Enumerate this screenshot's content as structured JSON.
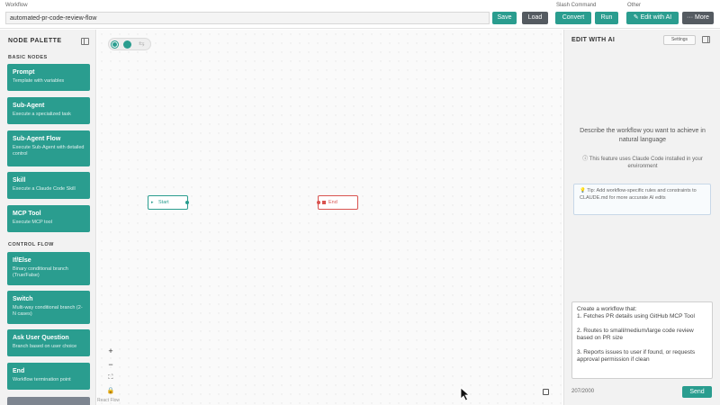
{
  "topbar": {
    "workflow_label": "Workflow",
    "workflow_name": "automated-pr-code-review-flow",
    "save_label": "Save",
    "load_label": "Load",
    "slash_label": "Slash Command",
    "convert_label": "Convert",
    "run_label": "Run",
    "other_label": "Other",
    "edit_ai_label": "Edit with AI",
    "more_label": "More"
  },
  "palette": {
    "title": "NODE PALETTE",
    "basic_section": "BASIC NODES",
    "control_section": "CONTROL FLOW",
    "basic_nodes": [
      {
        "title": "Prompt",
        "desc": "Template with variables"
      },
      {
        "title": "Sub-Agent",
        "desc": "Execute a specialized task"
      },
      {
        "title": "Sub-Agent Flow",
        "desc": "Execute Sub-Agent with detailed control"
      },
      {
        "title": "Skill",
        "desc": "Execute a Claude Code Skill"
      },
      {
        "title": "MCP Tool",
        "desc": "Execute MCP tool"
      }
    ],
    "control_nodes": [
      {
        "title": "If/Else",
        "desc": "Binary conditional branch (True/False)"
      },
      {
        "title": "Switch",
        "desc": "Multi-way conditional branch (2-N cases)"
      },
      {
        "title": "Ask User Question",
        "desc": "Branch based on user choice"
      },
      {
        "title": "End",
        "desc": "Workflow termination point"
      }
    ]
  },
  "canvas": {
    "start_label": "Start",
    "end_label": "End",
    "corner_text": "React Flow"
  },
  "ai_panel": {
    "title": "EDIT WITH AI",
    "settings_label": "Settings",
    "description": "Describe the workflow you want to achieve in natural language",
    "note": "This feature uses Claude Code installed in your environment",
    "tip": "Tip: Add workflow-specific rules and constraints to CLAUDE.md for more accurate AI edits",
    "prompt_text": "Create a workflow that:\n1. Fetches PR details using GitHub MCP Tool\n\n2. Routes to small/medium/large code review based on PR size\n\n3. Reports issues to user if found, or requests approval permission if clean",
    "char_count": "207/2000",
    "send_label": "Send"
  },
  "colors": {
    "accent": "#2a9d8f",
    "end_node": "#d9534f",
    "dark_button": "#555b61"
  }
}
